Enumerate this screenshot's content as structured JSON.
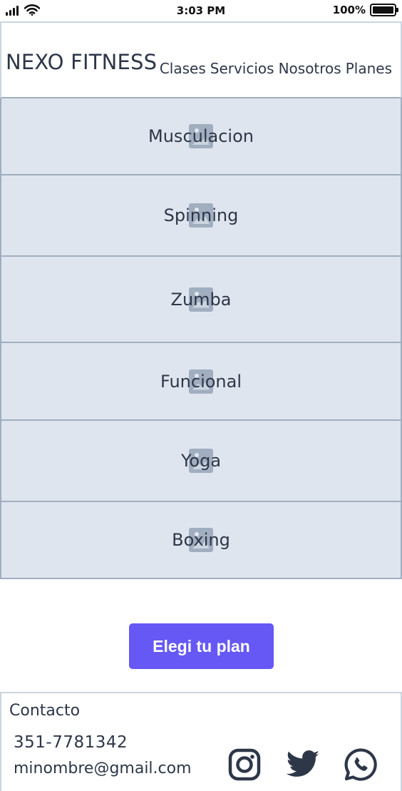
{
  "status_bar": {
    "time": "3:03 PM",
    "battery": "100%",
    "battery_level": 1.0,
    "icons": [
      "signal-icon",
      "wifi-icon",
      "battery-icon"
    ]
  },
  "header": {
    "brand": "NEXO FITNESS",
    "nav": [
      "Clases",
      "Servicios",
      "Nosotros",
      "Planes"
    ]
  },
  "classes": [
    "Musculacion",
    "Spinning",
    "Zumba",
    "Funcional",
    "Yoga",
    "Boxing"
  ],
  "cta": {
    "label": "Elegi tu plan",
    "color": "#6558f5"
  },
  "footer": {
    "title": "Contacto",
    "phone": "351-7781342",
    "email": "minombre@gmail.com",
    "social_icons": [
      "instagram-icon",
      "twitter-icon",
      "whatsapp-icon"
    ]
  },
  "colors": {
    "text": "#2d3748",
    "card_bg": "#dfe5ee",
    "border": "#a0aec0",
    "icon": "#2d3748"
  }
}
